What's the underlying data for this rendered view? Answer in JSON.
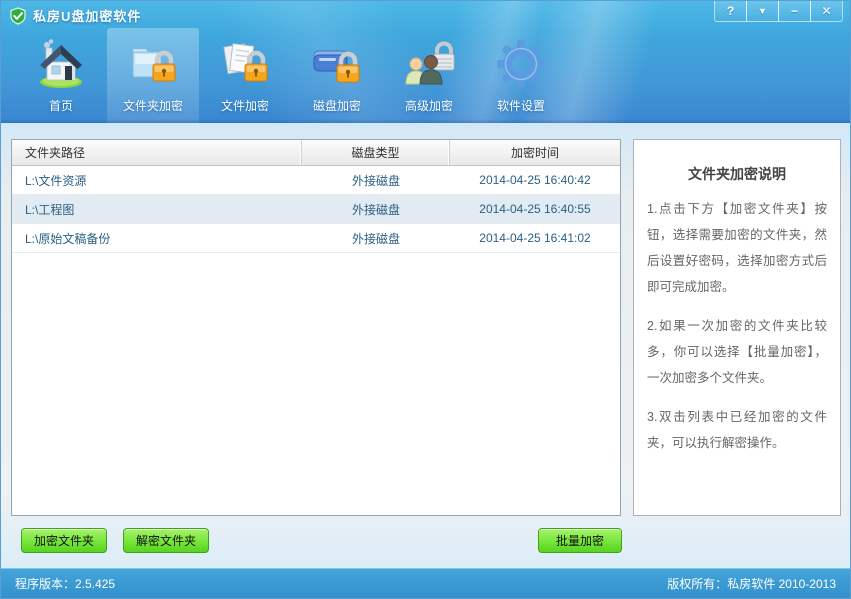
{
  "window": {
    "title": "私房U盘加密软件"
  },
  "titlebar": {
    "controls": [
      {
        "id": "help",
        "glyph": "?"
      },
      {
        "id": "skin",
        "glyph": "▼"
      },
      {
        "id": "minimize",
        "glyph": "−"
      },
      {
        "id": "close",
        "glyph": "✕"
      }
    ]
  },
  "nav": {
    "items": [
      {
        "id": "home",
        "label": "首页",
        "icon": "home-icon",
        "active": false
      },
      {
        "id": "folder-encrypt",
        "label": "文件夹加密",
        "icon": "folder-lock-icon",
        "active": true
      },
      {
        "id": "file-encrypt",
        "label": "文件加密",
        "icon": "file-lock-icon",
        "active": false
      },
      {
        "id": "disk-encrypt",
        "label": "磁盘加密",
        "icon": "disk-lock-icon",
        "active": false
      },
      {
        "id": "advanced-encrypt",
        "label": "高级加密",
        "icon": "users-lock-icon",
        "active": false
      },
      {
        "id": "settings",
        "label": "软件设置",
        "icon": "gear-icon",
        "active": false
      }
    ]
  },
  "table": {
    "headers": [
      "文件夹路径",
      "磁盘类型",
      "加密时间"
    ],
    "rows": [
      {
        "path": "L:\\文件资源",
        "type": "外接磁盘",
        "time": "2014-04-25 16:40:42"
      },
      {
        "path": "L:\\工程图",
        "type": "外接磁盘",
        "time": "2014-04-25 16:40:55"
      },
      {
        "path": "L:\\原始文稿备份",
        "type": "外接磁盘",
        "time": "2014-04-25 16:41:02"
      }
    ]
  },
  "help": {
    "title": "文件夹加密说明",
    "paragraphs": [
      "1.点击下方【加密文件夹】按钮，选择需要加密的文件夹，然后设置好密码，选择加密方式后即可完成加密。",
      "2.如果一次加密的文件夹比较多，你可以选择【批量加密】，一次加密多个文件夹。",
      "3.双击列表中已经加密的文件夹，可以执行解密操作。"
    ]
  },
  "actions": {
    "encrypt": "加密文件夹",
    "decrypt": "解密文件夹",
    "batch": "批量加密"
  },
  "statusbar": {
    "version": "程序版本：2.5.425",
    "copyright": "版权所有：私房软件 2010-2013"
  },
  "colors": {
    "titlebar_blue": "#3fa7dd",
    "toolbar_blue": "#4197d7",
    "status_blue": "#3697d0",
    "button_green": "#6ed935",
    "row_text": "#2a5f85",
    "alt_row_bg": "#e2ebf1"
  }
}
